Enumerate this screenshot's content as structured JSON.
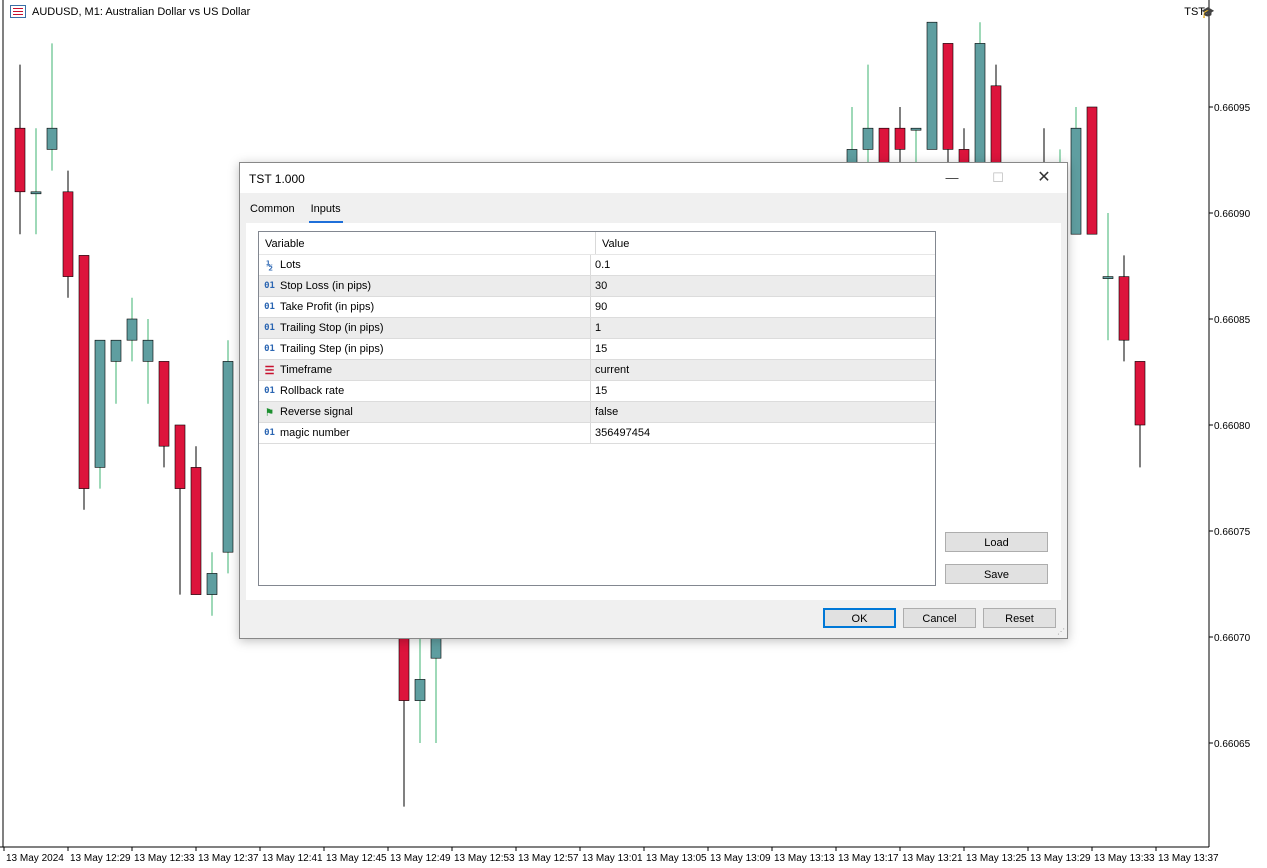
{
  "chart": {
    "symbol_label": "AUDUSD, M1:  Australian Dollar vs US Dollar",
    "ea_name": "TST",
    "price_labels": [
      "0.66095",
      "0.66090",
      "0.66085",
      "0.66080",
      "0.66075",
      "0.66070",
      "0.66065"
    ],
    "time_labels": [
      "13 May 2024",
      "13 May 12:29",
      "13 May 12:33",
      "13 May 12:37",
      "13 May 12:41",
      "13 May 12:45",
      "13 May 12:49",
      "13 May 12:53",
      "13 May 12:57",
      "13 May 13:01",
      "13 May 13:05",
      "13 May 13:09",
      "13 May 13:13",
      "13 May 13:17",
      "13 May 13:21",
      "13 May 13:25",
      "13 May 13:29",
      "13 May 13:33",
      "13 May 13:37"
    ],
    "colors": {
      "bull": "#5f9ea0",
      "bear": "#dc143c",
      "wick_bull": "#3cb371",
      "wick_bear": "#000000"
    },
    "candles": [
      {
        "o": 0.66094,
        "h": 0.66097,
        "l": 0.66089,
        "c": 0.66091
      },
      {
        "o": 0.66091,
        "h": 0.66094,
        "l": 0.66089,
        "c": 0.66091
      },
      {
        "o": 0.66093,
        "h": 0.66098,
        "l": 0.66092,
        "c": 0.66094
      },
      {
        "o": 0.66091,
        "h": 0.66092,
        "l": 0.66086,
        "c": 0.66087
      },
      {
        "o": 0.66088,
        "h": 0.66088,
        "l": 0.66076,
        "c": 0.66077
      },
      {
        "o": 0.66078,
        "h": 0.66084,
        "l": 0.66077,
        "c": 0.66084
      },
      {
        "o": 0.66083,
        "h": 0.66084,
        "l": 0.66081,
        "c": 0.66084
      },
      {
        "o": 0.66084,
        "h": 0.66086,
        "l": 0.66083,
        "c": 0.66085
      },
      {
        "o": 0.66083,
        "h": 0.66085,
        "l": 0.66081,
        "c": 0.66084
      },
      {
        "o": 0.66083,
        "h": 0.66083,
        "l": 0.66078,
        "c": 0.66079
      },
      {
        "o": 0.6608,
        "h": 0.6608,
        "l": 0.66072,
        "c": 0.66077
      },
      {
        "o": 0.66078,
        "h": 0.66079,
        "l": 0.66072,
        "c": 0.66072
      },
      {
        "o": 0.66072,
        "h": 0.66074,
        "l": 0.66071,
        "c": 0.66073
      },
      {
        "o": 0.66074,
        "h": 0.66084,
        "l": 0.66073,
        "c": 0.66083
      }
    ],
    "candles_mid": [
      {
        "o": 0.6607,
        "h": 0.6607,
        "l": 0.66062,
        "c": 0.66067
      },
      {
        "o": 0.66067,
        "h": 0.6607,
        "l": 0.66065,
        "c": 0.66068
      },
      {
        "o": 0.66069,
        "h": 0.6607,
        "l": 0.66065,
        "c": 0.6607
      }
    ],
    "candles_right": [
      {
        "o": 0.66092,
        "h": 0.66095,
        "l": 0.6609,
        "c": 0.66093
      },
      {
        "o": 0.66093,
        "h": 0.66097,
        "l": 0.66091,
        "c": 0.66094
      },
      {
        "o": 0.66094,
        "h": 0.66094,
        "l": 0.66091,
        "c": 0.66092
      },
      {
        "o": 0.66094,
        "h": 0.66095,
        "l": 0.66092,
        "c": 0.66093
      },
      {
        "o": 0.66094,
        "h": 0.66094,
        "l": 0.66092,
        "c": 0.66094
      },
      {
        "o": 0.66093,
        "h": 0.66099,
        "l": 0.66093,
        "c": 0.66099
      },
      {
        "o": 0.66098,
        "h": 0.66098,
        "l": 0.66092,
        "c": 0.66093
      },
      {
        "o": 0.66093,
        "h": 0.66094,
        "l": 0.66091,
        "c": 0.66092
      },
      {
        "o": 0.66091,
        "h": 0.66099,
        "l": 0.6609,
        "c": 0.66098
      },
      {
        "o": 0.66096,
        "h": 0.66097,
        "l": 0.6609,
        "c": 0.66091
      },
      {
        "o": 0.66087,
        "h": 0.66088,
        "l": 0.66083,
        "c": 0.66088
      },
      {
        "o": 0.66088,
        "h": 0.66092,
        "l": 0.66085,
        "c": 0.66092
      },
      {
        "o": 0.66091,
        "h": 0.66094,
        "l": 0.66089,
        "c": 0.6609
      },
      {
        "o": 0.66089,
        "h": 0.66093,
        "l": 0.66088,
        "c": 0.6609
      },
      {
        "o": 0.66089,
        "h": 0.66095,
        "l": 0.66089,
        "c": 0.66094
      },
      {
        "o": 0.66095,
        "h": 0.66095,
        "l": 0.66089,
        "c": 0.66089
      },
      {
        "o": 0.66087,
        "h": 0.6609,
        "l": 0.66084,
        "c": 0.66087
      },
      {
        "o": 0.66087,
        "h": 0.66088,
        "l": 0.66083,
        "c": 0.66084
      },
      {
        "o": 0.66083,
        "h": 0.66083,
        "l": 0.66078,
        "c": 0.6608
      }
    ]
  },
  "dialog": {
    "title": "TST 1.000",
    "tabs": [
      "Common",
      "Inputs"
    ],
    "active_tab": "Inputs",
    "headers": [
      "Variable",
      "Value"
    ],
    "rows": [
      {
        "icon": "fraction-icon",
        "name": "Lots",
        "value": "0.1"
      },
      {
        "icon": "integer-icon",
        "name": "Stop Loss (in pips)",
        "value": "30"
      },
      {
        "icon": "integer-icon",
        "name": "Take Profit (in pips)",
        "value": "90"
      },
      {
        "icon": "integer-icon",
        "name": "Trailing Stop (in pips)",
        "value": "1"
      },
      {
        "icon": "integer-icon",
        "name": "Trailing Step (in pips)",
        "value": "15"
      },
      {
        "icon": "enum-icon",
        "name": "Timeframe",
        "value": "current"
      },
      {
        "icon": "integer-icon",
        "name": "Rollback rate",
        "value": "15"
      },
      {
        "icon": "bool-flag-icon",
        "name": "Reverse signal",
        "value": "false"
      },
      {
        "icon": "integer-icon",
        "name": "magic number",
        "value": "356497454"
      }
    ],
    "buttons": {
      "load": "Load",
      "save": "Save",
      "ok": "OK",
      "cancel": "Cancel",
      "reset": "Reset"
    },
    "icon_glyphs": {
      "integer": "01",
      "fraction": "½",
      "enum": "☰",
      "flag": "⚑"
    }
  }
}
